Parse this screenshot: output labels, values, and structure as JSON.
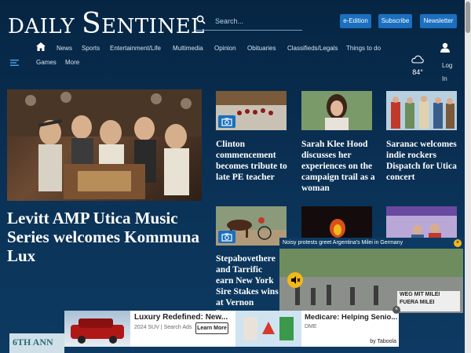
{
  "header": {
    "logo_left": "DAILY",
    "logo_s": "S",
    "logo_right": "ENTINEL",
    "search_placeholder": "Search...",
    "buttons": {
      "eedition": "e-Edition",
      "subscribe": "Subscribe",
      "newsletter": "Newsletter"
    }
  },
  "nav": {
    "items": [
      "News",
      "Sports",
      "Entertainment/Life",
      "Multimedia",
      "Opinion",
      "Obituaries",
      "Classifieds/Legals",
      "Things to do",
      "Games",
      "More"
    ],
    "weather_temp": "84°",
    "login": "Log In"
  },
  "hero": {
    "title": "Levitt AMP Utica Music Series welcomes Kommuna Lux"
  },
  "stories": [
    {
      "title": "Clinton commencement becomes tribute to late PE teacher"
    },
    {
      "title": "Sarah Klee Hood discusses her experiences on the campaign trail as a woman"
    },
    {
      "title": "Saranac welcomes indie rockers Dispatch for Utica concert"
    },
    {
      "title": "Stepabovethere and Tarrific earn New York Sire Stakes wins at Vernon Downs"
    }
  ],
  "video": {
    "title": "Noisy protests greet Argentina's Milei in Germany",
    "close": "×",
    "sign": "WEG MIT MILEI FUERA MILEI"
  },
  "ad": {
    "title1": "Luxury Redefined: New...",
    "sub1": "2024 SUV | Search Ads",
    "learn_more": "Learn More",
    "title2": "Medicare: Helping Senio...",
    "sub2": "DME",
    "by": "by Taboola",
    "close": "×"
  },
  "partial_text": "6TH ANN",
  "colors": {
    "accent": "#1a6fbf",
    "background": "#0b3358",
    "highlight": "#f2b81c"
  }
}
